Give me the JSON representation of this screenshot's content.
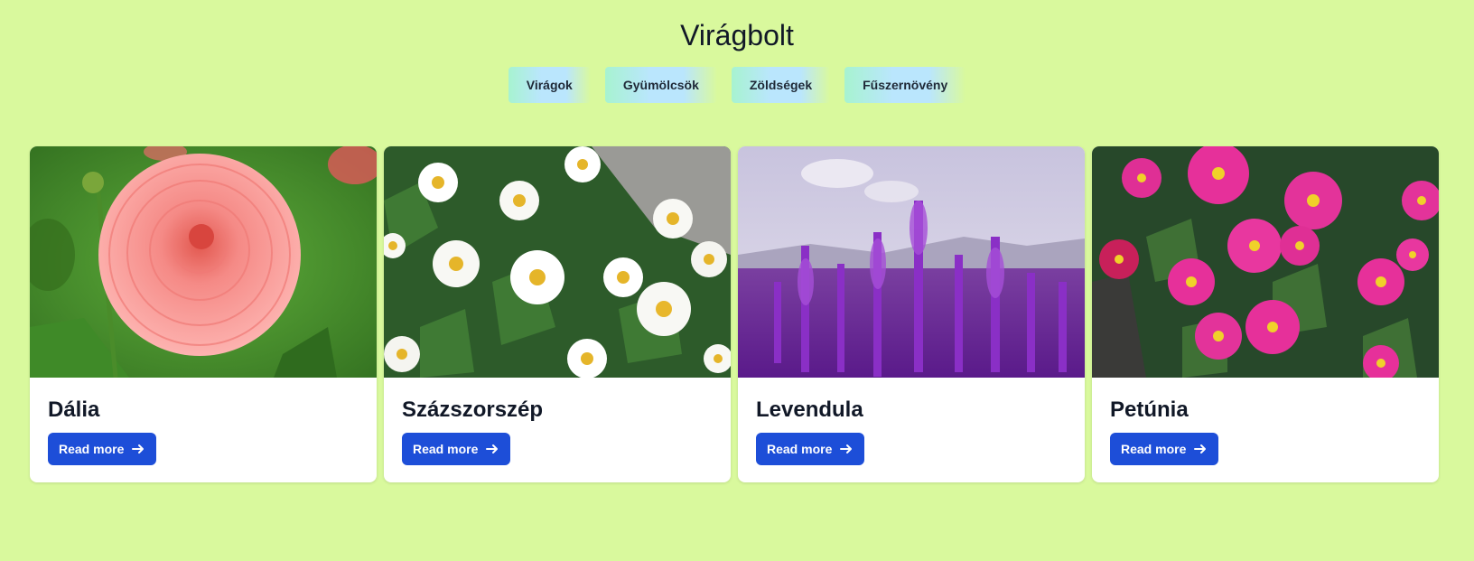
{
  "header": {
    "title": "Virágbolt"
  },
  "tabs": [
    {
      "label": "Virágok"
    },
    {
      "label": "Gyümölcsök"
    },
    {
      "label": "Zöldségek"
    },
    {
      "label": "Fűszernövény"
    }
  ],
  "cards": [
    {
      "title": "Dália",
      "button_label": "Read more",
      "image_icon": "dahlia-photo"
    },
    {
      "title": "Százszorszép",
      "button_label": "Read more",
      "image_icon": "daisy-photo"
    },
    {
      "title": "Levendula",
      "button_label": "Read more",
      "image_icon": "lavender-photo"
    },
    {
      "title": "Petúnia",
      "button_label": "Read more",
      "image_icon": "petunia-photo"
    }
  ],
  "colors": {
    "background": "#d9f99d",
    "button": "#1d4ed8",
    "card": "#ffffff"
  }
}
